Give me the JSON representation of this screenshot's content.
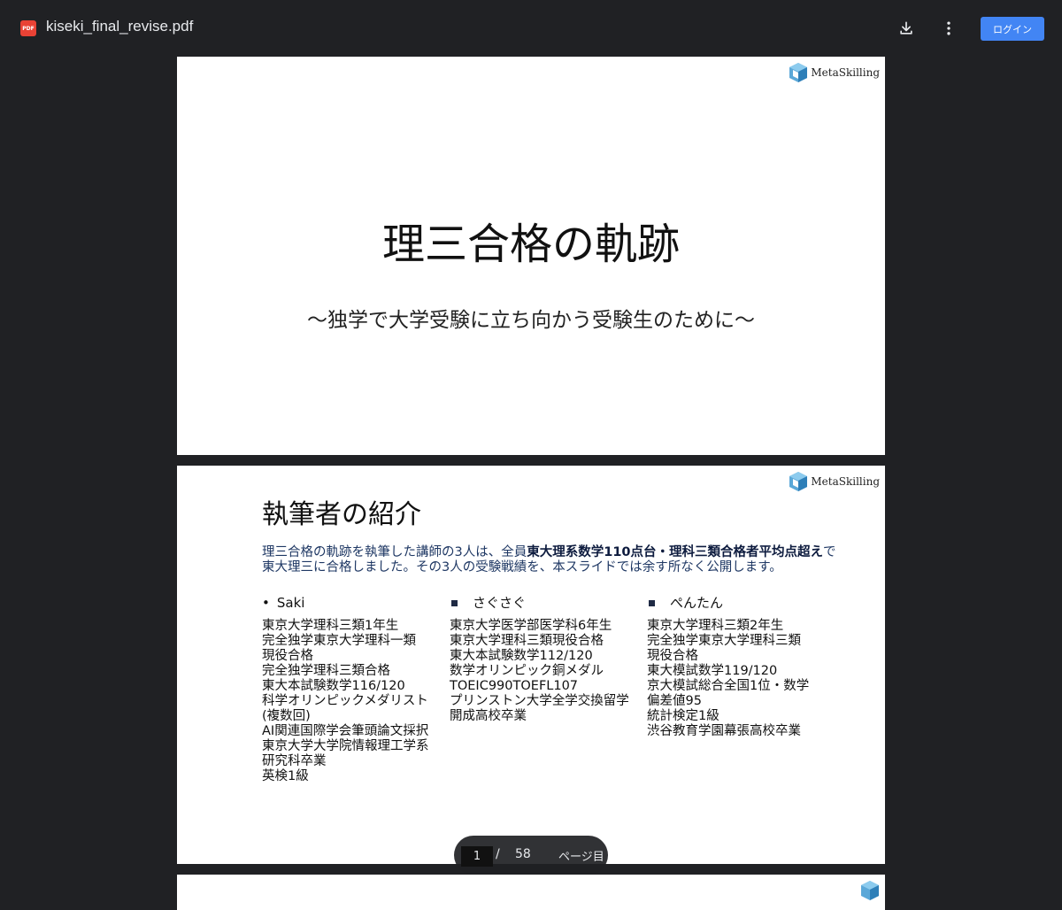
{
  "toolbar": {
    "pdf_badge": "PDF",
    "filename": "kiseki_final_revise.pdf",
    "download_icon": "download-icon",
    "more_icon": "more-vert-icon",
    "login_label": "ログイン",
    "accent_color": "#4285f4"
  },
  "logo": {
    "text": "MetaSkilling"
  },
  "slide1": {
    "title": "理三合格の軌跡",
    "subtitle": "～独学で大学受験に立ち向かう受験生のために～"
  },
  "slide2": {
    "title": "執筆者の紹介",
    "intro_part1": "理三合格の軌跡を執筆した講師の3人は、全員",
    "intro_bold": "東大理系数学110点台・理科三類合格者平均点超え",
    "intro_part2": "で東大理三に合格しました。その3人の受験戦績を、本スライドでは余す所なく公開します。",
    "authors": [
      {
        "bullet": "•",
        "name": "Saki",
        "lines": [
          "東京大学理科三類1年生",
          "完全独学東京大学理科一類",
          "現役合格",
          "完全独学理科三類合格",
          "東大本試験数学116/120",
          "科学オリンピックメダリスト",
          "(複数回)",
          "AI関連国際学会筆頭論文採択",
          "東京大学大学院情報理工学系",
          "研究科卒業",
          "英検1級"
        ]
      },
      {
        "bullet": "■",
        "name": "さぐさぐ",
        "lines": [
          "東京大学医学部医学科6年生",
          "東京大学理科三類現役合格",
          "東大本試験数学112/120",
          "数学オリンピック銅メダル",
          "TOEIC990TOEFL107",
          "プリンストン大学全学交換留学",
          "開成高校卒業"
        ]
      },
      {
        "bullet": "■",
        "name": "ぺんたん",
        "lines": [
          "東京大学理科三類2年生",
          "完全独学東京大学理科三類",
          "現役合格",
          "東大模試数学119/120",
          "京大模試総合全国1位・数学",
          "偏差値95",
          "統計検定1級",
          "渋谷教育学園幕張高校卒業"
        ]
      }
    ]
  },
  "pager": {
    "current_page": "1",
    "separator": "/",
    "total_pages": "58",
    "unit_label": "ページ目"
  }
}
